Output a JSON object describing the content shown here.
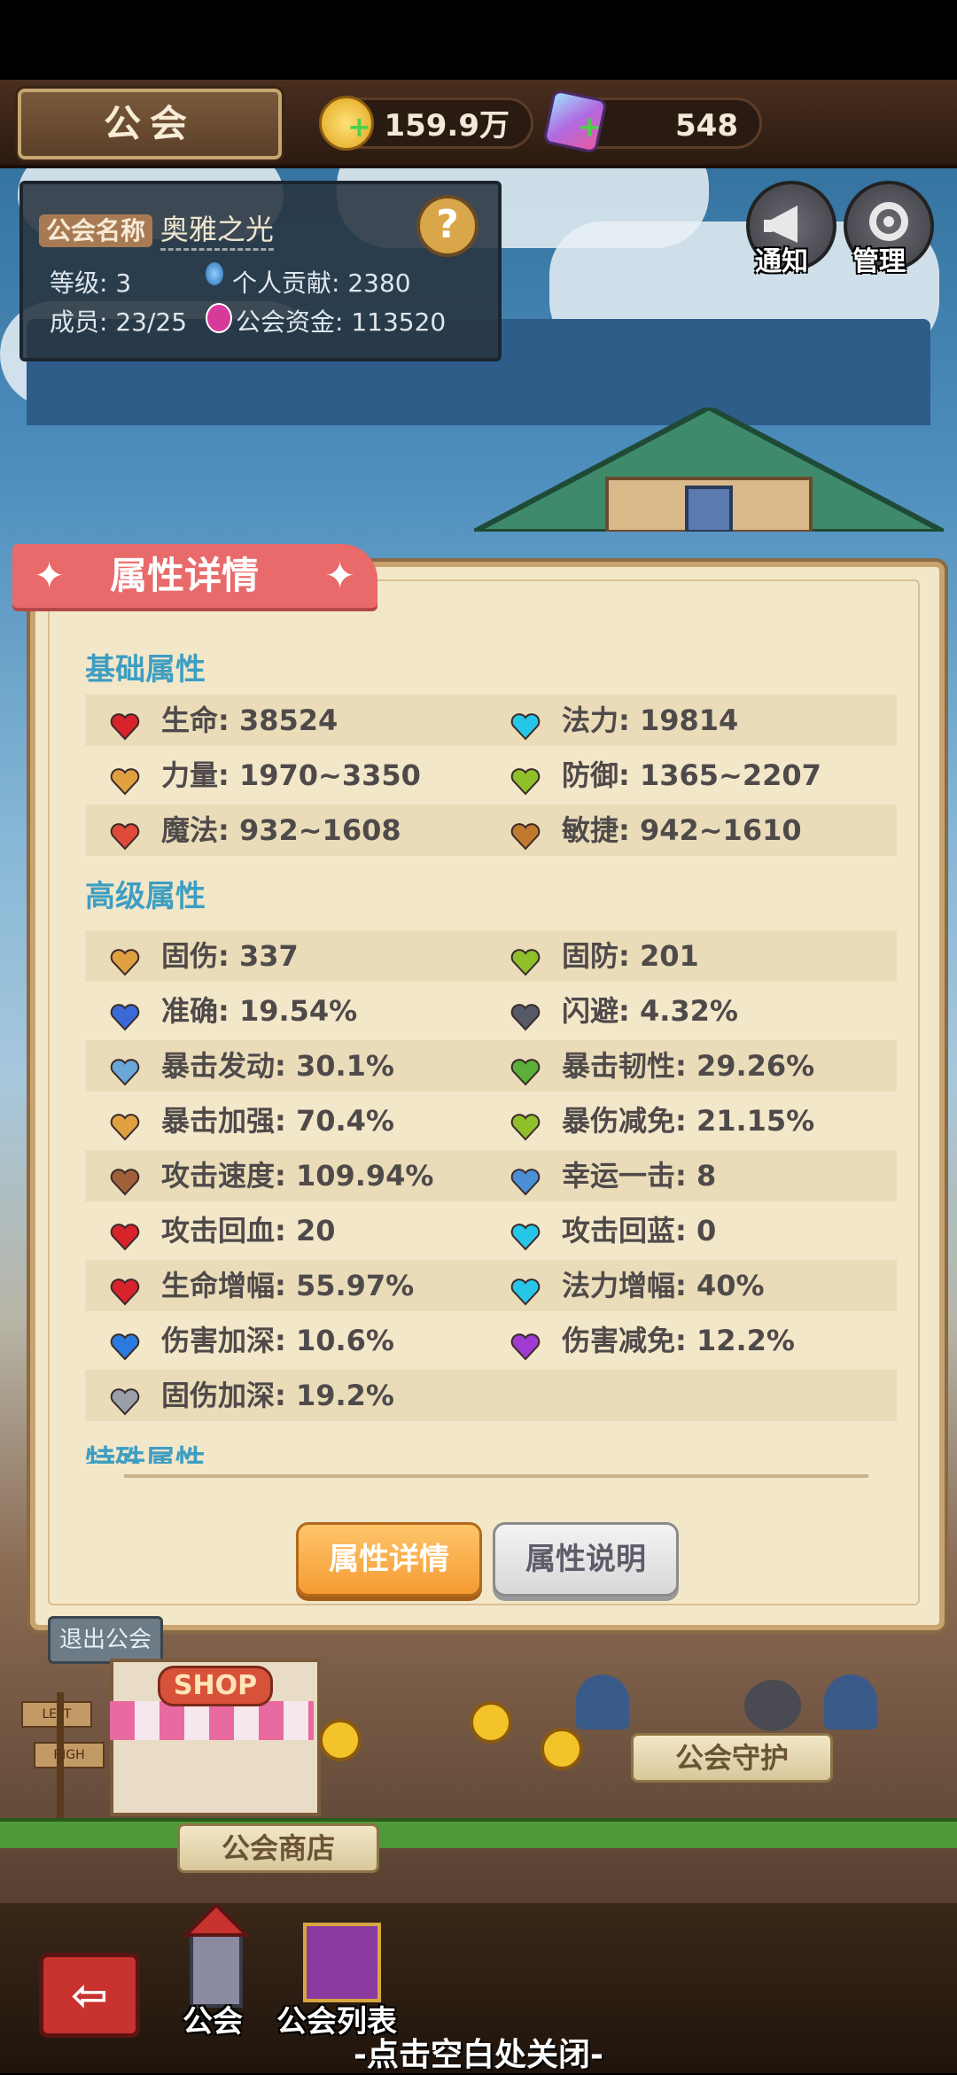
{
  "header": {
    "title": "公会",
    "gold_amount": "159.9万",
    "gem_amount": "548"
  },
  "guild": {
    "name_label": "公会名称",
    "name": "奥雅之光",
    "help_symbol": "?",
    "level_label": "等级: 3",
    "contribution_label": "个人贡献: 2380",
    "members_label": "成员: 23/25",
    "funds_label": "公会资金: 113520"
  },
  "top_buttons": {
    "notice": "通知",
    "manage": "管理"
  },
  "modal": {
    "title": "属性详情",
    "basic_section": "基础属性",
    "basic": [
      {
        "icon": "heart-icon",
        "color": "#d8232a",
        "text": "生命: 38524"
      },
      {
        "icon": "mana-heart-icon",
        "color": "#26c6e6",
        "text": "法力: 19814"
      },
      {
        "icon": "sword-icon",
        "color": "#e0a040",
        "text": "力量: 1970~3350"
      },
      {
        "icon": "shield-icon",
        "color": "#8fbf2a",
        "text": "防御: 1365~2207"
      },
      {
        "icon": "magic-wand-icon",
        "color": "#e04a3a",
        "text": "魔法: 932~1608"
      },
      {
        "icon": "bow-icon",
        "color": "#c07a30",
        "text": "敏捷: 942~1610"
      }
    ],
    "advanced_section": "高级属性",
    "advanced": [
      {
        "icon": "sword-icon",
        "color": "#e0a040",
        "text": "固伤: 337"
      },
      {
        "icon": "shield-icon",
        "color": "#8fbf2a",
        "text": "固防: 201"
      },
      {
        "icon": "accuracy-icon",
        "color": "#3a6ad6",
        "text": "准确: 19.54%"
      },
      {
        "icon": "dodge-icon",
        "color": "#555a66",
        "text": "闪避: 4.32%"
      },
      {
        "icon": "crit-trigger-icon",
        "color": "#6aa6d8",
        "text": "暴击发动: 30.1%"
      },
      {
        "icon": "crit-resist-icon",
        "color": "#5ab03a",
        "text": "暴击韧性: 29.26%"
      },
      {
        "icon": "crit-boost-icon",
        "color": "#e0a040",
        "text": "暴击加强: 70.4%"
      },
      {
        "icon": "crit-reduce-icon",
        "color": "#8fbf2a",
        "text": "暴伤减免: 21.15%"
      },
      {
        "icon": "attack-speed-icon",
        "color": "#a0603a",
        "text": "攻击速度: 109.94%"
      },
      {
        "icon": "lucky-strike-icon",
        "color": "#4a8fd6",
        "text": "幸运一击: 8"
      },
      {
        "icon": "heart-icon",
        "color": "#d8232a",
        "text": "攻击回血: 20"
      },
      {
        "icon": "mana-heart-icon",
        "color": "#26c6e6",
        "text": "攻击回蓝: 0"
      },
      {
        "icon": "heart-icon",
        "color": "#d8232a",
        "text": "生命增幅: 55.97%"
      },
      {
        "icon": "mana-heart-icon",
        "color": "#26c6e6",
        "text": "法力增幅: 40%"
      },
      {
        "icon": "flame-icon",
        "color": "#2a7ae0",
        "text": "伤害加深: 10.6%"
      },
      {
        "icon": "orb-icon",
        "color": "#a03ad0",
        "text": "伤害减免: 12.2%"
      },
      {
        "icon": "blade-icon",
        "color": "#9aa0aa",
        "text": "固伤加深: 19.2%"
      }
    ],
    "special_section": "特殊属性",
    "btn_detail": "属性详情",
    "btn_explain": "属性说明"
  },
  "scene": {
    "leave_guild": "退出公会",
    "shop_sign": "SHOP",
    "guild_guard": "公会守护",
    "guild_shop": "公会商店",
    "sign_left": "LEFT",
    "sign_right": "RIGH"
  },
  "bottom_nav": {
    "exit_symbol": "⇦",
    "guild": "公会",
    "guild_list": "公会列表",
    "close_hint": "-点击空白处关闭-"
  }
}
